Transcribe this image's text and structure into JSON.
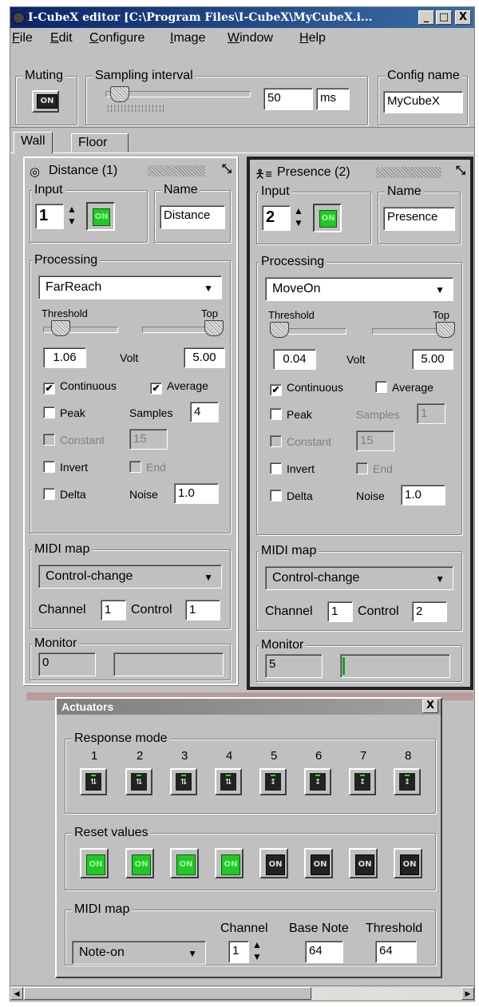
{
  "window": {
    "title": "I-CubeX editor [C:\\Program Files\\I-CubeX\\MyCubeX.i...",
    "buttons": [
      "_",
      "□",
      "X"
    ]
  },
  "menu": [
    "File",
    "Edit",
    "Configure",
    "Image",
    "Window",
    "Help"
  ],
  "toolbar": {
    "muting_label": "Muting",
    "muting_button": "ON",
    "sampling_label": "Sampling interval",
    "sampling_value": "50",
    "sampling_unit": "ms",
    "config_label": "Config name",
    "config_value": "MyCubeX"
  },
  "tabs": [
    "Wall",
    "Floor"
  ],
  "panels": [
    {
      "title": "Distance (1)",
      "icon": "target-icon",
      "input_label": "Input",
      "input_value": "1",
      "on": "ON",
      "name_label": "Name",
      "name_value": "Distance",
      "processing_label": "Processing",
      "processing_value": "FarReach",
      "threshold_label": "Threshold",
      "top_label": "Top",
      "threshold_value": "1.06",
      "volt_label": "Volt",
      "top_value": "5.00",
      "continuous": "Continuous",
      "average": "Average",
      "peak": "Peak",
      "samples_label": "Samples",
      "samples_value": "4",
      "constant": "Constant",
      "constant_value": "15",
      "invert": "Invert",
      "end": "End",
      "delta": "Delta",
      "noise_label": "Noise",
      "noise_value": "1.0",
      "midi_label": "MIDI map",
      "midi_value": "Control-change",
      "channel_label": "Channel",
      "channel_value": "1",
      "control_label": "Control",
      "control_value": "1",
      "monitor_label": "Monitor",
      "monitor_value": "0",
      "check_mark": "✔"
    },
    {
      "title": "Presence (2)",
      "icon": "person-icon",
      "input_label": "Input",
      "input_value": "2",
      "on": "ON",
      "name_label": "Name",
      "name_value": "Presence",
      "processing_label": "Processing",
      "processing_value": "MoveOn",
      "threshold_label": "Threshold",
      "top_label": "Top",
      "threshold_value": "0.04",
      "volt_label": "Volt",
      "top_value": "5.00",
      "continuous": "Continuous",
      "average": "Average",
      "peak": "Peak",
      "samples_label": "Samples",
      "samples_value": "1",
      "constant": "Constant",
      "constant_value": "15",
      "invert": "Invert",
      "end": "End",
      "delta": "Delta",
      "noise_label": "Noise",
      "noise_value": "1.0",
      "midi_label": "MIDI map",
      "midi_value": "Control-change",
      "channel_label": "Channel",
      "channel_value": "1",
      "control_label": "Control",
      "control_value": "2",
      "monitor_label": "Monitor",
      "monitor_value": "5",
      "check_mark": "✔"
    }
  ],
  "actuators": {
    "title": "Actuators",
    "close": "X",
    "response_label": "Response mode",
    "columns": [
      "1",
      "2",
      "3",
      "4",
      "5",
      "6",
      "7",
      "8"
    ],
    "reset_label": "Reset values",
    "reset_on": "ON",
    "midi_label": "MIDI map",
    "channel_label": "Channel",
    "base_note_label": "Base Note",
    "threshold_label": "Threshold",
    "midi_value": "Note-on",
    "channel_value": "1",
    "base_note_value": "64",
    "threshold_value": "64"
  }
}
